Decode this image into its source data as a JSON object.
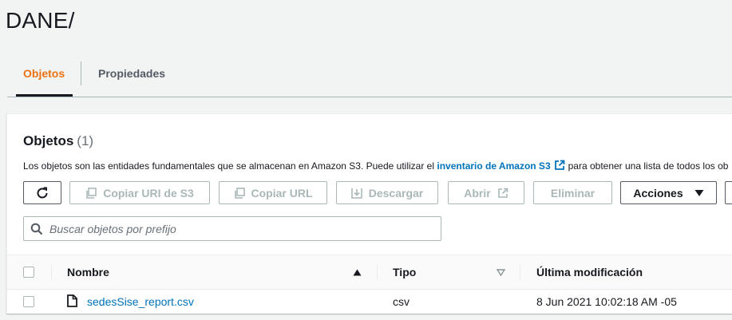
{
  "page": {
    "title": "DANE/"
  },
  "tabs": [
    {
      "label": "Objetos",
      "active": true
    },
    {
      "label": "Propiedades",
      "active": false
    }
  ],
  "objects": {
    "heading": "Objetos",
    "count": "(1)",
    "description_before": "Los objetos son las entidades fundamentales que se almacenan en Amazon S3. Puede utilizar el",
    "description_link": "inventario de Amazon S3",
    "description_after": "para obtener una lista de todos los ob"
  },
  "toolbar": {
    "refresh_icon": "refresh-icon",
    "copy_uri_label": "Copiar URI de S3",
    "copy_url_label": "Copiar URL",
    "download_label": "Descargar",
    "open_label": "Abrir",
    "delete_label": "Eliminar",
    "actions_label": "Acciones"
  },
  "search": {
    "placeholder": "Buscar objetos por prefijo",
    "value": ""
  },
  "table": {
    "headers": {
      "name": "Nombre",
      "type": "Tipo",
      "modified": "Última modificación"
    },
    "rows": [
      {
        "name": "sedesSise_report.csv",
        "type": "csv",
        "modified": "8 Jun 2021 10:02:18 AM -05"
      }
    ]
  },
  "colors": {
    "accent": "#ec7211",
    "link": "#0073bb",
    "text": "#16191f",
    "disabled": "#aab7b8",
    "background": "#f2f3f3"
  }
}
